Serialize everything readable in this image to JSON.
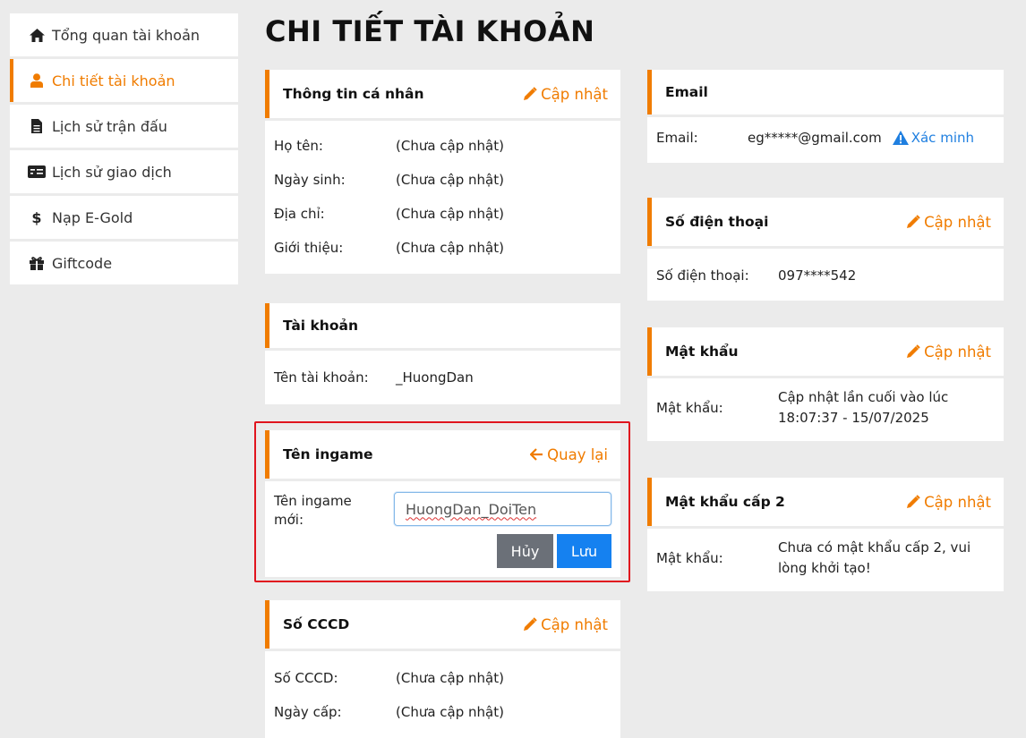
{
  "sidebar": {
    "items": [
      {
        "label": "Tổng quan tài khoản",
        "icon": "home-icon"
      },
      {
        "label": "Chi tiết tài khoản",
        "icon": "user-icon"
      },
      {
        "label": "Lịch sử trận đấu",
        "icon": "document-icon"
      },
      {
        "label": "Lịch sử giao dịch",
        "icon": "card-icon"
      },
      {
        "label": "Nạp E-Gold",
        "icon": "dollar-icon"
      },
      {
        "label": "Giftcode",
        "icon": "gift-icon"
      }
    ]
  },
  "page_title": "CHI TIẾT TÀI KHOẢN",
  "personal": {
    "title": "Thông tin cá nhân",
    "action": "Cập nhật",
    "rows": [
      {
        "label": "Họ tên:",
        "value": "(Chưa cập nhật)"
      },
      {
        "label": "Ngày sinh:",
        "value": "(Chưa cập nhật)"
      },
      {
        "label": "Địa chỉ:",
        "value": "(Chưa cập nhật)"
      },
      {
        "label": "Giới thiệu:",
        "value": "(Chưa cập nhật)"
      }
    ]
  },
  "account": {
    "title": "Tài khoản",
    "rows": [
      {
        "label": "Tên tài khoản:",
        "value": "_HuongDan"
      }
    ]
  },
  "ingame": {
    "title": "Tên ingame",
    "action": "Quay lại",
    "label_line1": "Tên ingame",
    "label_line2": "mới:",
    "input_value": "HuongDan_DoiTen",
    "cancel": "Hủy",
    "save": "Lưu"
  },
  "cccd": {
    "title": "Số CCCD",
    "action": "Cập nhật",
    "rows": [
      {
        "label": "Số CCCD:",
        "value": "(Chưa cập nhật)"
      },
      {
        "label": "Ngày cấp:",
        "value": "(Chưa cập nhật)"
      }
    ]
  },
  "email": {
    "title": "Email",
    "label": "Email:",
    "value": "eg*****@gmail.com",
    "verify": "Xác minh"
  },
  "phone": {
    "title": "Số điện thoại",
    "action": "Cập nhật",
    "label": "Số điện thoại:",
    "value": "097****542"
  },
  "password": {
    "title": "Mật khẩu",
    "action": "Cập nhật",
    "label": "Mật khẩu:",
    "value_line1": "Cập nhật lần cuối vào lúc",
    "value_line2": "18:07:37 - 15/07/2025"
  },
  "password2": {
    "title": "Mật khẩu cấp 2",
    "action": "Cập nhật",
    "label": "Mật khẩu:",
    "value_line1": "Chưa có mật khẩu cấp 2, vui",
    "value_line2": "lòng khởi tạo!"
  },
  "colors": {
    "accent": "#f07c00",
    "primary": "#1581f0",
    "secondary": "#6b7078",
    "highlight": "#e0141e"
  }
}
